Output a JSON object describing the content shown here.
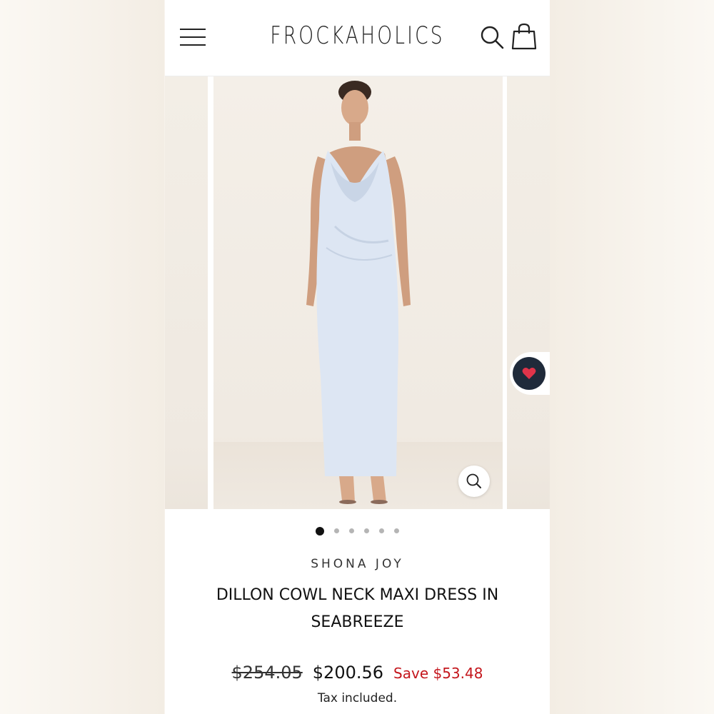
{
  "header": {
    "logo_text": "FROCKAHOLICS",
    "menu_icon": "hamburger-menu-icon",
    "search_icon": "search-icon",
    "cart_icon": "shopping-bag-icon"
  },
  "gallery": {
    "image_count": 6,
    "active_index": 0,
    "zoom_icon": "magnifier-icon",
    "wishlist_icon": "heart-icon",
    "colors": {
      "wishlist_bg": "#1f2a3a",
      "heart": "#e0344a",
      "dress": "#dde6f3"
    }
  },
  "product": {
    "brand": "SHONA JOY",
    "title": "DILLON COWL NECK MAXI DRESS IN SEABREEZE",
    "compare_price": "$254.05",
    "price": "$200.56",
    "save_text": "Save $53.48",
    "tax_note": "Tax included."
  },
  "colors": {
    "accent_sale": "#c4161c",
    "text": "#111111"
  }
}
